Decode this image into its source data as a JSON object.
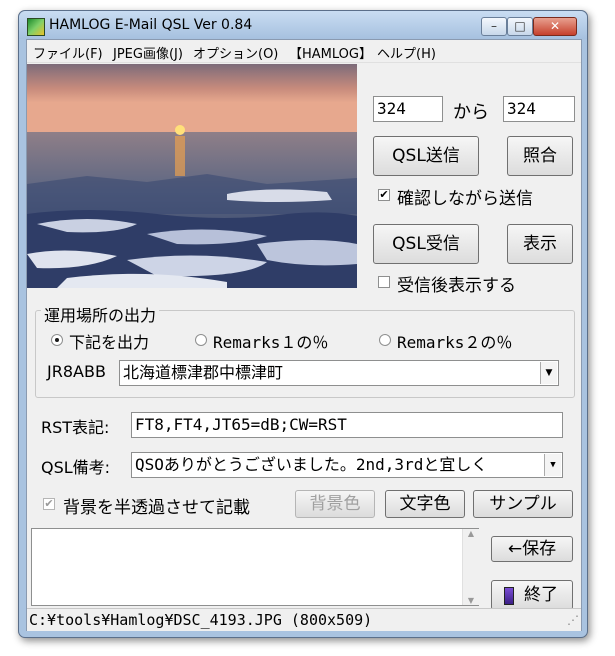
{
  "window": {
    "title": "HAMLOG E-Mail QSL Ver 0.84",
    "controls": {
      "minimize": "–",
      "maximize": "□",
      "close": "✕"
    }
  },
  "menu": {
    "items": [
      "ファイル(F)",
      "JPEG画像(J)",
      "オプション(O)",
      "【HAMLOG】",
      "ヘルプ(H)"
    ]
  },
  "range": {
    "from_value": "324",
    "to_value": "324",
    "from_label": "から"
  },
  "buttons": {
    "qsl_send": "QSL送信",
    "lookup": "照合",
    "qsl_receive": "QSL受信",
    "display": "表示",
    "bg_color": "背景色",
    "text_color": "文字色",
    "sample": "サンプル",
    "save": "←保存",
    "exit": "終了"
  },
  "checks": {
    "confirm_send": {
      "label": "確認しながら送信",
      "checked": true
    },
    "show_after_receive": {
      "label": "受信後表示する",
      "checked": false
    },
    "semi_transparent": {
      "label": "背景を半透過させて記載",
      "checked": true
    }
  },
  "location": {
    "group_title": "運用場所の出力",
    "options": [
      "下記を出力",
      "Remarks１の％",
      "Remarks２の％"
    ],
    "selected": 0,
    "callsign": "JR8ABB",
    "address": "北海道標津郡中標津町"
  },
  "rst": {
    "label": "RST表記:",
    "value": "FT8,FT4,JT65=dB;CW=RST"
  },
  "qsl_note": {
    "label": "QSL備考:",
    "value": "QSOありがとうございました。2nd,3rdと宜しく"
  },
  "memo": {
    "value": ""
  },
  "status": {
    "path": "C:¥tools¥Hamlog¥DSC_4193.JPG (800x509)"
  }
}
